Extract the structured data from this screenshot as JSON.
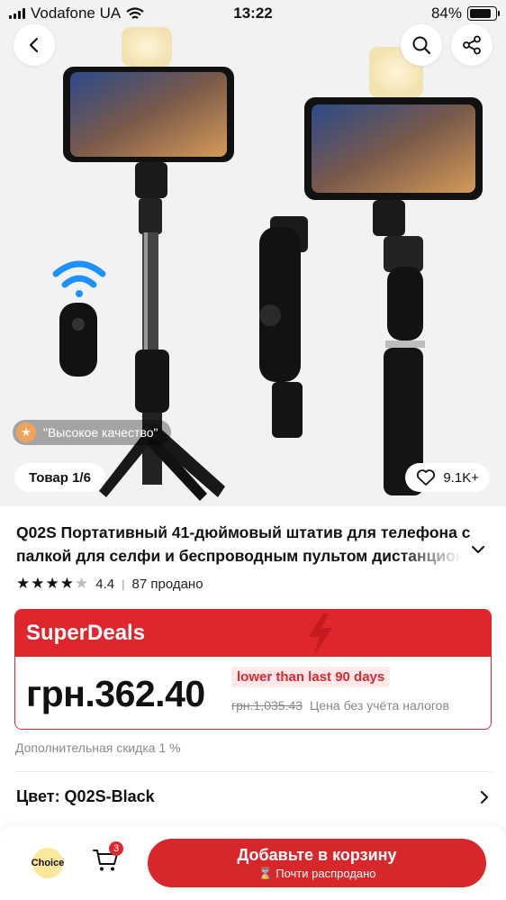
{
  "status_bar": {
    "carrier": "Vodafone UA",
    "time": "13:22",
    "battery": "84%",
    "battery_level": 0.84
  },
  "gallery": {
    "quality_badge": "\"Высокое качество\"",
    "counter": "Товар 1/6",
    "wishlist_count": "9.1K+"
  },
  "product": {
    "title_line1": "Q02S Портативный 41-дюймовый штатив для телефона с",
    "title_line2": "палкой для селфи и беспроводным пультом дистанционного",
    "rating": "4.4",
    "sold": "87 продано",
    "rating_stars": 4.4
  },
  "deal": {
    "brand": "SuperDeals",
    "price": "грн.362.40",
    "lower_tag": "lower than last 90 days",
    "old_price": "грн.1,035.43",
    "tax_note": "Цена без учёта налогов",
    "accent_color": "#e0262d"
  },
  "extra_discount": "Дополнительная скидка 1 %",
  "color": {
    "label": "Цвет: Q02S-Black"
  },
  "bottom_bar": {
    "choice_label": "Choice",
    "cart_count": "3",
    "add_button": "Добавьте в корзину",
    "add_button_sub": "Почти распродано"
  },
  "icons": {
    "back": "chevron-left-icon",
    "search": "search-icon",
    "share": "share-icon",
    "heart": "heart-icon",
    "cart": "cart-icon",
    "hourglass": "hourglass-icon"
  }
}
